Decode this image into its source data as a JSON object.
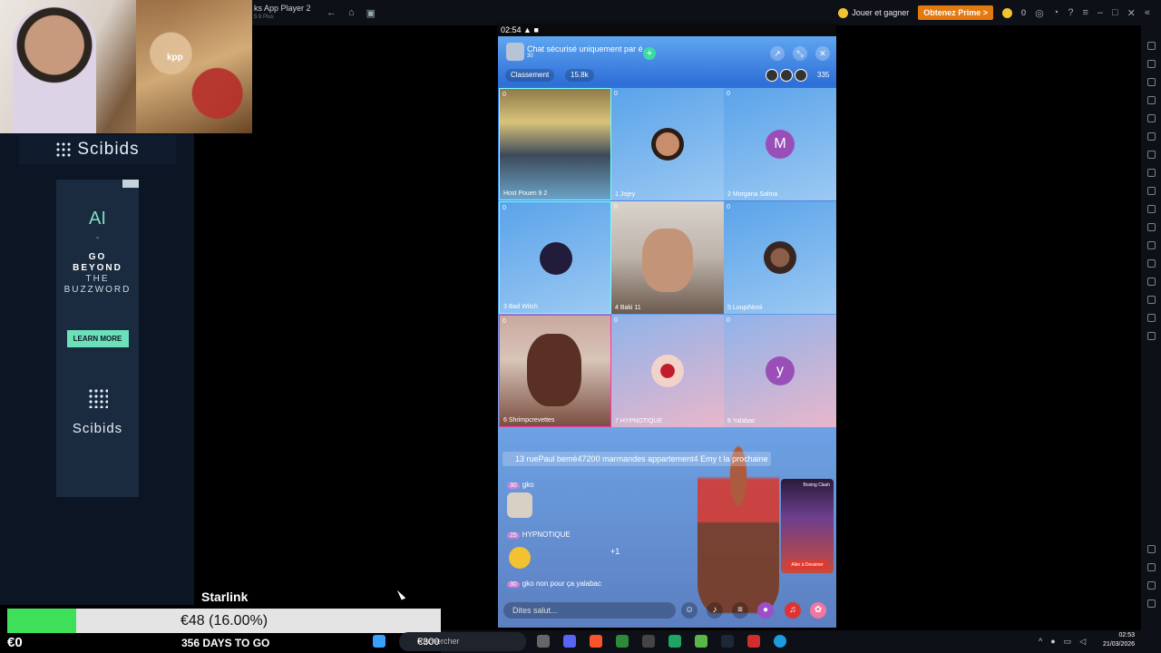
{
  "emulator": {
    "title": "ks App Player 2",
    "subtitle": "5.9 Plus",
    "jouer_label": "Jouer et gagner",
    "prime_label": "Obtenez Prime >",
    "coins": "0"
  },
  "stream_overlay": {
    "webcam_text": "kpp",
    "ad": {
      "brand": "Scibids",
      "headline": "AI",
      "dash": "-",
      "line1": "GO",
      "line2": "BEYOND",
      "line3": "THE",
      "line4": "BUZZWORD",
      "cta": "LEARN MORE"
    },
    "goal": {
      "name": "Starlink",
      "amount_text": "€48 (16.00%)",
      "progress_percent": 16,
      "left_label": "€0",
      "days_label": "356 DAYS TO GO"
    }
  },
  "phone": {
    "status_time": "02:54",
    "chat_title": "Chat sécurisé uniquement par é",
    "chat_sub": "30",
    "ranking_label": "Classement",
    "score": "15.8k",
    "viewer_count": "335",
    "seats": [
      {
        "index": "Host",
        "name": "Pouen 9 2",
        "count": "0"
      },
      {
        "index": "1",
        "name": "Jojey",
        "count": "0"
      },
      {
        "index": "2",
        "name": "Morgana Salma",
        "count": "0",
        "letter": "M"
      },
      {
        "index": "3",
        "name": "Bad Witch",
        "count": "0"
      },
      {
        "index": "4",
        "name": "Baki 11",
        "count": "0"
      },
      {
        "index": "5",
        "name": "LoupiNimii",
        "count": "0"
      },
      {
        "index": "6",
        "name": "Shrimpcrevettes",
        "count": "0"
      },
      {
        "index": "7",
        "name": "HYPNOTIQUE",
        "count": "0"
      },
      {
        "index": "8",
        "name": "Yalabac",
        "count": "0",
        "letter": "y"
      }
    ],
    "banner_text": "13 ruePaul bemé47200 marmandes appartement4 Emy t la prochaine",
    "chat": [
      {
        "level": "30",
        "user": "gko",
        "text": ""
      },
      {
        "level": "25",
        "user": "HYPNOTIQUE",
        "text": ""
      },
      {
        "level": "30",
        "user": "gko",
        "text": "non pour ça yalabac"
      }
    ],
    "plus_one": "+1",
    "game_title": "Boxing Clash",
    "game_btn": "Aller à Dessiner",
    "input_placeholder": "Dites salut..."
  },
  "taskbar": {
    "search_text": "Rechercher",
    "search_overlay": "€300",
    "time": "02:53",
    "date": "21/03/2026"
  }
}
